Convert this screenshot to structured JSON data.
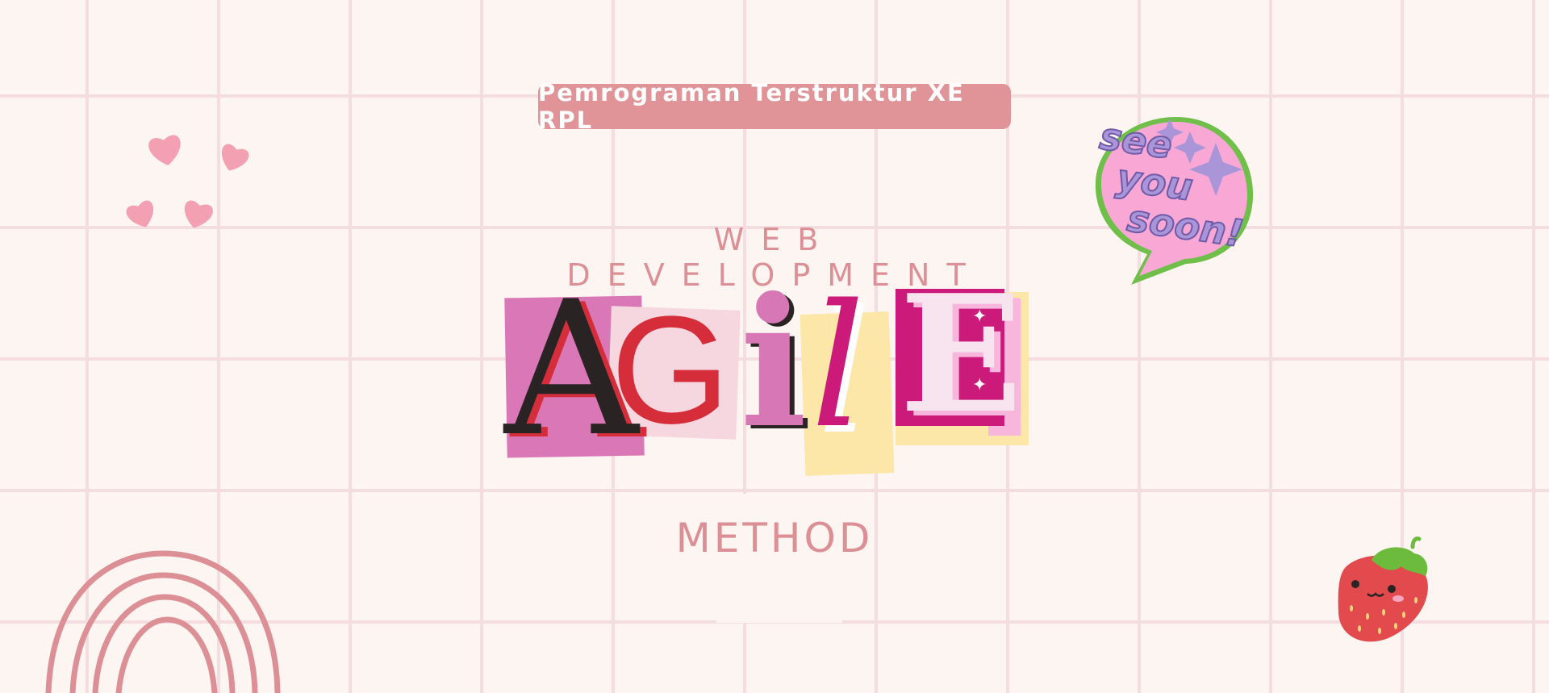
{
  "header": {
    "course_title": "Pemrograman Terstruktur XE RPL"
  },
  "hero": {
    "subtitle": "WEB DEVELOPMENT",
    "title_letters": [
      "A",
      "G",
      "i",
      "l",
      "E"
    ],
    "method_label": "METHOD"
  },
  "stickers": {
    "speech_bubble": {
      "line1": "see",
      "line2": "you",
      "line3": "soon!"
    }
  },
  "colors": {
    "background": "#fdf5f1",
    "grid": "#f4dde0",
    "accent_pink": "#dc9095",
    "hot_pink": "#cc1a7a",
    "lavender": "#a995d8"
  }
}
